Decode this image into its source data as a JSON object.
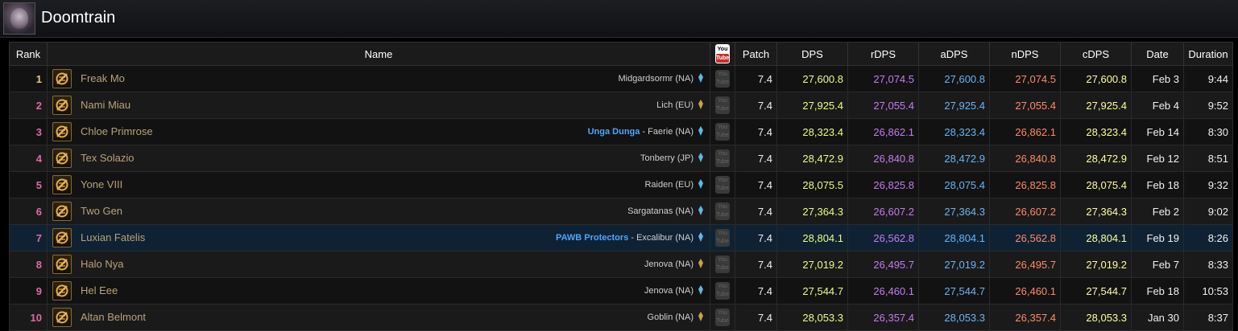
{
  "encounter": {
    "title": "Doomtrain"
  },
  "columns": [
    "Rank",
    "Name",
    "",
    "Patch",
    "DPS",
    "rDPS",
    "aDPS",
    "nDPS",
    "cDPS",
    "Date",
    "Duration"
  ],
  "youtube_header": {
    "line1": "You",
    "line2": "Tube"
  },
  "youtube_cell": {
    "line1": "You",
    "line2": "Tube"
  },
  "colors": {
    "rank_orange": "#ff8000",
    "rank_pink": "#e268a8",
    "dps": "#e9ff83",
    "rdps": "#c67bf2",
    "adps": "#6ab5f5",
    "ndps": "#ff8a6a",
    "cdps": "#ffff9c",
    "guild": "#4ea5ff",
    "highlight_row": "#0e2233"
  },
  "rows": [
    {
      "rank": "1",
      "name": "Freak Mo",
      "guild": "",
      "server": "Midgardsormr (NA)",
      "crystal": "blue",
      "patch": "7.4",
      "dps": "27,600.8",
      "rdps": "27,074.5",
      "adps": "27,600.8",
      "ndps": "27,074.5",
      "cdps": "27,600.8",
      "date": "Feb 3",
      "duration": "9:44"
    },
    {
      "rank": "2",
      "name": "Nami Miau",
      "guild": "",
      "server": "Lich (EU)",
      "crystal": "gold",
      "patch": "7.4",
      "dps": "27,925.4",
      "rdps": "27,055.4",
      "adps": "27,925.4",
      "ndps": "27,055.4",
      "cdps": "27,925.4",
      "date": "Feb 4",
      "duration": "9:52"
    },
    {
      "rank": "3",
      "name": "Chloe Primrose",
      "guild": "Unga Dunga",
      "server": " - Faerie (NA)",
      "crystal": "blue",
      "patch": "7.4",
      "dps": "28,323.4",
      "rdps": "26,862.1",
      "adps": "28,323.4",
      "ndps": "26,862.1",
      "cdps": "28,323.4",
      "date": "Feb 14",
      "duration": "8:30"
    },
    {
      "rank": "4",
      "name": "Tex Solazio",
      "guild": "",
      "server": "Tonberry (JP)",
      "crystal": "blue",
      "patch": "7.4",
      "dps": "28,472.9",
      "rdps": "26,840.8",
      "adps": "28,472.9",
      "ndps": "26,840.8",
      "cdps": "28,472.9",
      "date": "Feb 12",
      "duration": "8:51"
    },
    {
      "rank": "5",
      "name": "Yone VIII",
      "guild": "",
      "server": "Raiden (EU)",
      "crystal": "blue",
      "patch": "7.4",
      "dps": "28,075.5",
      "rdps": "26,825.8",
      "adps": "28,075.4",
      "ndps": "26,825.8",
      "cdps": "28,075.4",
      "date": "Feb 18",
      "duration": "9:32"
    },
    {
      "rank": "6",
      "name": "Two Gen",
      "guild": "",
      "server": "Sargatanas (NA)",
      "crystal": "blue",
      "patch": "7.4",
      "dps": "27,364.3",
      "rdps": "26,607.2",
      "adps": "27,364.3",
      "ndps": "26,607.2",
      "cdps": "27,364.3",
      "date": "Feb 2",
      "duration": "9:02"
    },
    {
      "rank": "7",
      "name": "Luxian Fatelis",
      "guild": "PAWB Protectors",
      "server": " - Excalibur (NA)",
      "crystal": "blue",
      "patch": "7.4",
      "dps": "28,804.1",
      "rdps": "26,562.8",
      "adps": "28,804.1",
      "ndps": "26,562.8",
      "cdps": "28,804.1",
      "date": "Feb 19",
      "duration": "8:26"
    },
    {
      "rank": "8",
      "name": "Halo Nya",
      "guild": "",
      "server": "Jenova (NA)",
      "crystal": "gold",
      "patch": "7.4",
      "dps": "27,019.2",
      "rdps": "26,495.7",
      "adps": "27,019.2",
      "ndps": "26,495.7",
      "cdps": "27,019.2",
      "date": "Feb 7",
      "duration": "8:33"
    },
    {
      "rank": "9",
      "name": "Hel Eee",
      "guild": "",
      "server": "Jenova (NA)",
      "crystal": "blue",
      "patch": "7.4",
      "dps": "27,544.7",
      "rdps": "26,460.1",
      "adps": "27,544.7",
      "ndps": "26,460.1",
      "cdps": "27,544.7",
      "date": "Feb 18",
      "duration": "10:53"
    },
    {
      "rank": "10",
      "name": "Altan Belmont",
      "guild": "",
      "server": "Goblin (NA)",
      "crystal": "gold",
      "patch": "7.4",
      "dps": "28,053.3",
      "rdps": "26,357.4",
      "adps": "28,053.3",
      "ndps": "26,357.4",
      "cdps": "28,053.3",
      "date": "Jan 30",
      "duration": "8:37"
    }
  ]
}
